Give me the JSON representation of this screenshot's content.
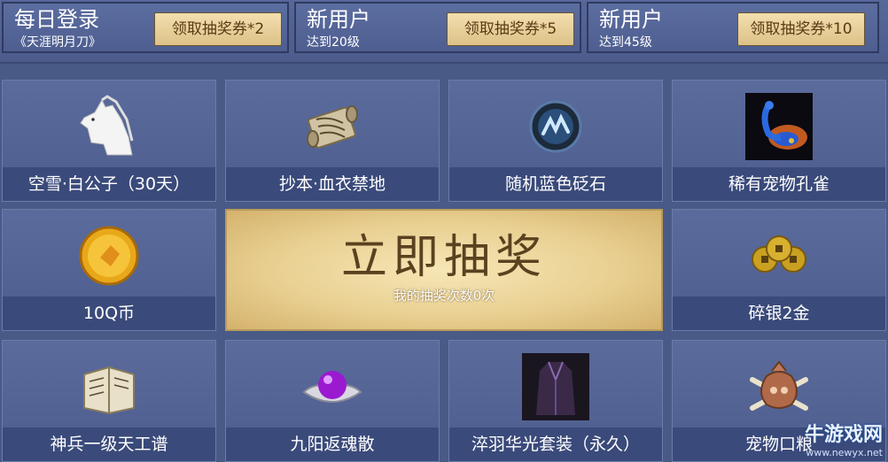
{
  "tasks": [
    {
      "title": "每日登录",
      "subtitle": "《天涯明月刀》",
      "button": "领取抽奖券*2"
    },
    {
      "title": "新用户",
      "subtitle": "达到20级",
      "button": "领取抽奖券*5"
    },
    {
      "title": "新用户",
      "subtitle": "达到45级",
      "button": "领取抽奖券*10"
    }
  ],
  "prizes": [
    {
      "label": "空雪·白公子（30天）",
      "icon": "white-horse-icon"
    },
    {
      "label": "抄本·血衣禁地",
      "icon": "scroll-icon"
    },
    {
      "label": "随机蓝色砭石",
      "icon": "blue-stone-icon"
    },
    {
      "label": "稀有宠物孔雀",
      "icon": "peacock-icon"
    },
    {
      "label": "10Q币",
      "icon": "gold-coin-icon"
    },
    {
      "label": "碎银2金",
      "icon": "silver-coins-icon"
    },
    {
      "label": "神兵一级天工谱",
      "icon": "book-icon"
    },
    {
      "label": "九阳返魂散",
      "icon": "pearl-shell-icon"
    },
    {
      "label": "淬羽华光套装（永久）",
      "icon": "costume-icon"
    },
    {
      "label": "宠物口粮",
      "icon": "food-bag-icon"
    }
  ],
  "draw": {
    "title": "立即抽奖",
    "count_text": "我的抽奖次数0次"
  },
  "watermark": {
    "text": "牛游戏网",
    "url": "www.newyx.net"
  },
  "colors": {
    "background": "#4a5a86",
    "label_bar": "#3a4a7a",
    "gold_button": "#dcc188"
  }
}
